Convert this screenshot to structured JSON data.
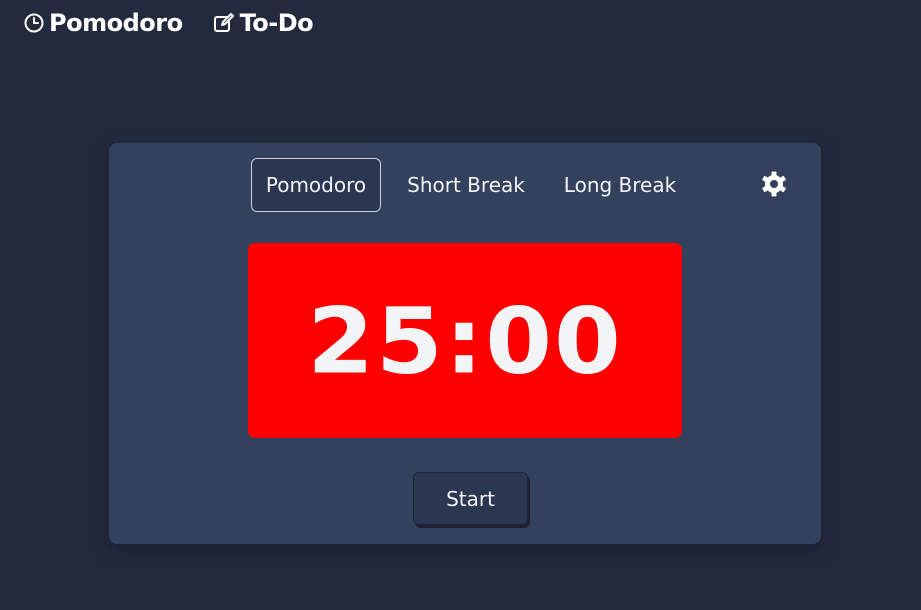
{
  "nav": {
    "items": [
      {
        "label": "Pomodoro",
        "icon": "clock-icon"
      },
      {
        "label": "To-Do",
        "icon": "edit-icon"
      }
    ]
  },
  "timer_card": {
    "tabs": [
      {
        "label": "Pomodoro",
        "active": true
      },
      {
        "label": "Short Break",
        "active": false
      },
      {
        "label": "Long Break",
        "active": false
      }
    ],
    "settings_icon": "gear-icon",
    "time_display": "25:00",
    "start_label": "Start"
  },
  "colors": {
    "background": "#232a3e",
    "card": "#33415c",
    "timer_box": "#ff0000",
    "text": "#f1f3f7"
  }
}
